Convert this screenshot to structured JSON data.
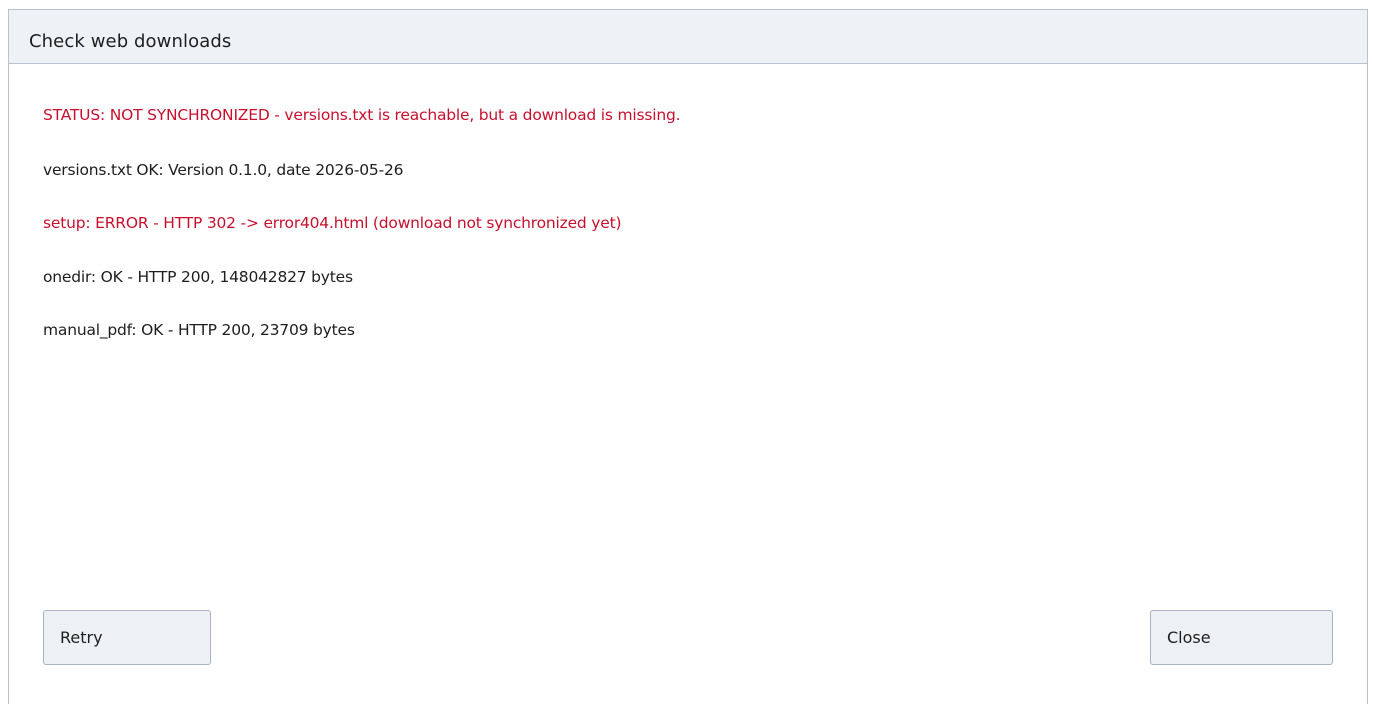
{
  "window": {
    "title": "Check web downloads"
  },
  "messages": [
    {
      "text": "STATUS: NOT SYNCHRONIZED - versions.txt is reachable, but a download is missing.",
      "status": "error"
    },
    {
      "text": "versions.txt OK: Version 0.1.0, date 2026-05-26",
      "status": "ok"
    },
    {
      "text": "setup: ERROR - HTTP 302 -> error404.html (download not synchronized yet)",
      "status": "error"
    },
    {
      "text": "onedir: OK - HTTP 200, 148042827 bytes",
      "status": "ok"
    },
    {
      "text": "manual_pdf: OK - HTTP 200, 23709 bytes",
      "status": "ok"
    }
  ],
  "buttons": {
    "retry_label": "Retry",
    "close_label": "Close"
  },
  "colors": {
    "error_text": "#c8102e",
    "normal_text": "#1e1e1e",
    "titlebar_bg": "#eef2f6",
    "button_bg": "#edf0f4"
  }
}
